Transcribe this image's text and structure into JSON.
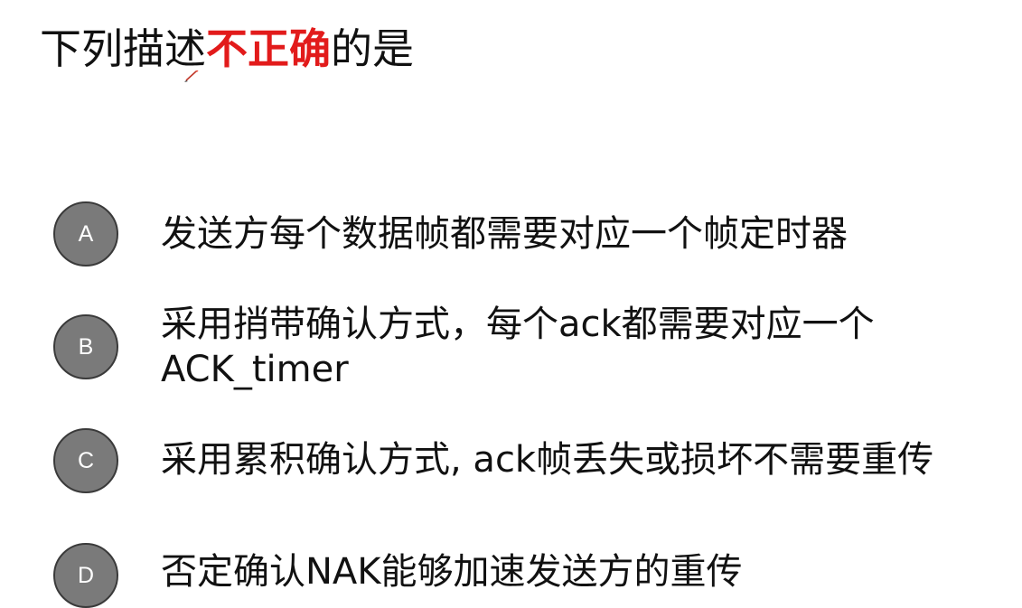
{
  "question": {
    "prefix": "下列描述",
    "emphasis": "不正确",
    "suffix": "的是",
    "emphasis_color": "#e21b1b"
  },
  "options": [
    {
      "letter": "A",
      "text_line1": "发送方每个数据帧都需要对应一个帧定时器"
    },
    {
      "letter": "B",
      "text_line1": "采用捎带确认方式，每个ack都需要对应一个",
      "text_line2": "ACK_timer"
    },
    {
      "letter": "C",
      "text_line1": "采用累积确认方式, ack帧丢失或损坏不需要重传"
    },
    {
      "letter": "D",
      "text_line1": "否定确认NAK能够加速发送方的重传"
    }
  ],
  "icons": {
    "pointer": "red-pen-cursor-icon"
  },
  "colors": {
    "circle_fill": "#7a7a7a",
    "circle_border": "#3a3a3a",
    "text": "#111111"
  }
}
